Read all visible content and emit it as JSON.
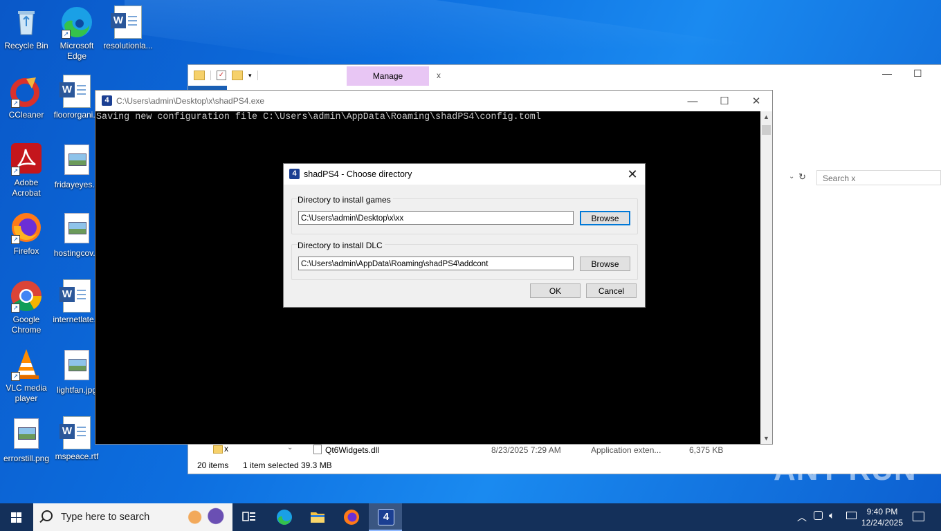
{
  "desktop": {
    "icons": [
      {
        "label": "Recycle Bin"
      },
      {
        "label": "Microsoft Edge"
      },
      {
        "label": "resolutionla..."
      },
      {
        "label": "CCleaner"
      },
      {
        "label": "floororgani..."
      },
      {
        "label": "Adobe Acrobat"
      },
      {
        "label": "fridayeyes..."
      },
      {
        "label": "Firefox"
      },
      {
        "label": "hostingcov..."
      },
      {
        "label": "Google Chrome"
      },
      {
        "label": "internetlate..."
      },
      {
        "label": "VLC media player"
      },
      {
        "label": "lightfan.jpg"
      },
      {
        "label": "errorstill.png"
      },
      {
        "label": "mspeace.rtf"
      }
    ]
  },
  "explorer": {
    "manage_tab": "Manage",
    "tab_x": "x",
    "search_placeholder": "Search x",
    "row": {
      "folder_name": "x",
      "file_name": "Qt6Widgets.dll",
      "date": "8/23/2025 7:29 AM",
      "type": "Application exten...",
      "size": "6,375 KB"
    },
    "status": {
      "items": "20 items",
      "selected": "1 item selected",
      "size": "39.3 MB"
    }
  },
  "console": {
    "title": "C:\\Users\\admin\\Desktop\\x\\shadPS4.exe",
    "output": "Saving new configuration file C:\\Users\\admin\\AppData\\Roaming\\shadPS4\\config.toml"
  },
  "dialog": {
    "title": "shadPS4 - Choose directory",
    "games_label": "Directory to install games",
    "games_path": "C:\\Users\\admin\\Desktop\\x\\xx",
    "dlc_label": "Directory to install DLC",
    "dlc_path": "C:\\Users\\admin\\AppData\\Roaming\\shadPS4\\addcont",
    "browse_label": "Browse",
    "ok_label": "OK",
    "cancel_label": "Cancel"
  },
  "taskbar": {
    "search_placeholder": "Type here to search",
    "time": "9:40 PM",
    "date": "12/24/2025"
  },
  "app_icon_glyph": "4",
  "watermark": "ANY RUN",
  "colors": {
    "accent": "#0078d7",
    "taskbar": "#14305a",
    "manage_tab": "#e8c6f4"
  }
}
